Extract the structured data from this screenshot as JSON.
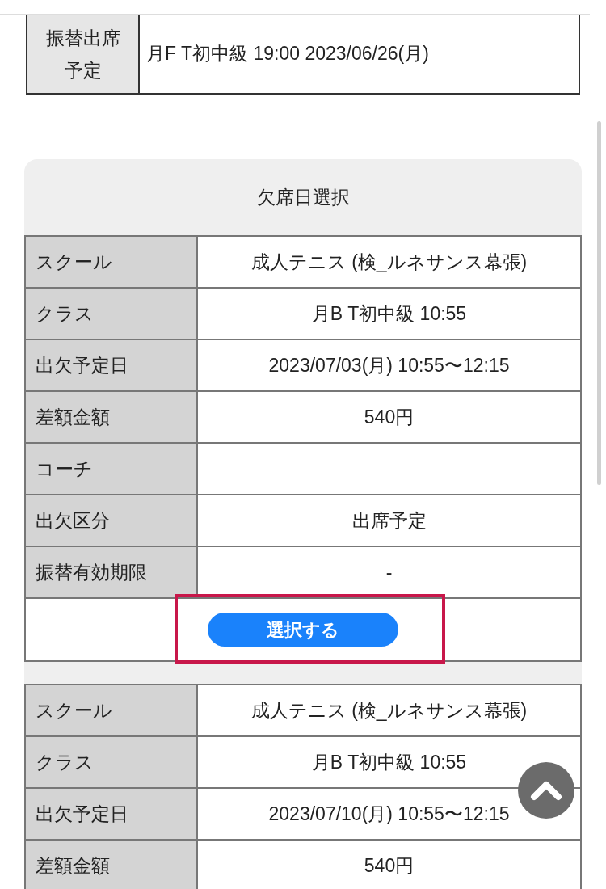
{
  "top_table": {
    "rows": [
      {
        "label": "振替出席予定",
        "value": "月F T初中級 19:00 2023/06/26(月)"
      }
    ]
  },
  "absence_panel": {
    "title": "欠席日選択",
    "records": [
      {
        "rows": [
          {
            "label": "スクール",
            "value": "成人テニス (検_ルネサンス幕張)"
          },
          {
            "label": "クラス",
            "value": "月B T初中級 10:55"
          },
          {
            "label": "出欠予定日",
            "value": "2023/07/03(月) 10:55〜12:15"
          },
          {
            "label": "差額金額",
            "value": "540円"
          },
          {
            "label": "コーチ",
            "value": ""
          },
          {
            "label": "出欠区分",
            "value": "出席予定"
          },
          {
            "label": "振替有効期限",
            "value": "-"
          }
        ],
        "button": {
          "label": "選択する",
          "highlighted": true
        }
      },
      {
        "rows": [
          {
            "label": "スクール",
            "value": "成人テニス (検_ルネサンス幕張)"
          },
          {
            "label": "クラス",
            "value": "月B T初中級 10:55"
          },
          {
            "label": "出欠予定日",
            "value": "2023/07/10(月) 10:55〜12:15"
          },
          {
            "label": "差額金額",
            "value": "540円"
          }
        ]
      }
    ]
  }
}
